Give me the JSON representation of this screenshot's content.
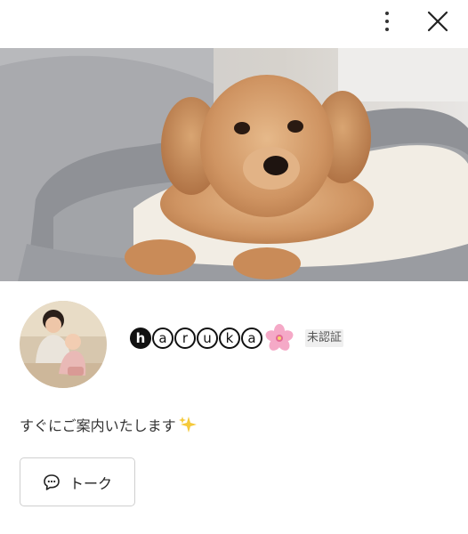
{
  "header": {
    "more_icon": "more-vertical-icon",
    "close_icon": "close-icon"
  },
  "cover": {
    "alt": ""
  },
  "profile": {
    "name_letters": [
      "h",
      "a",
      "r",
      "u",
      "k",
      "a"
    ],
    "name_emoji": "🌸",
    "badge": "未認証",
    "bio": "すぐにご案内いたします",
    "bio_emoji": "✨"
  },
  "actions": {
    "talk_label": "トーク",
    "talk_icon": "chat-bubble-icon"
  },
  "colors": {
    "text": "#222222",
    "border": "#cfcfcf",
    "badge_bg": "#efefef"
  }
}
